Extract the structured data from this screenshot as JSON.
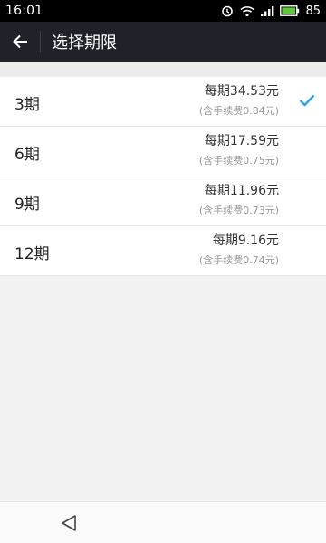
{
  "status": {
    "time": "16:01",
    "battery": "85",
    "icons": [
      "alarm-icon",
      "wifi-icon",
      "signal-icon",
      "battery-icon"
    ]
  },
  "appbar": {
    "title": "选择期限",
    "back_icon": "arrow-left-icon"
  },
  "options": [
    {
      "term": "3期",
      "per_period": "每期34.53元",
      "fee": "(含手续费0.84元)",
      "selected": true
    },
    {
      "term": "6期",
      "per_period": "每期17.59元",
      "fee": "(含手续费0.75元)",
      "selected": false
    },
    {
      "term": "9期",
      "per_period": "每期11.96元",
      "fee": "(含手续费0.73元)",
      "selected": false
    },
    {
      "term": "12期",
      "per_period": "每期9.16元",
      "fee": "(含手续费0.74元)",
      "selected": false
    }
  ],
  "colors": {
    "appbar": "#1f2228",
    "check": "#29a3e6",
    "background": "#f2f2f2"
  }
}
